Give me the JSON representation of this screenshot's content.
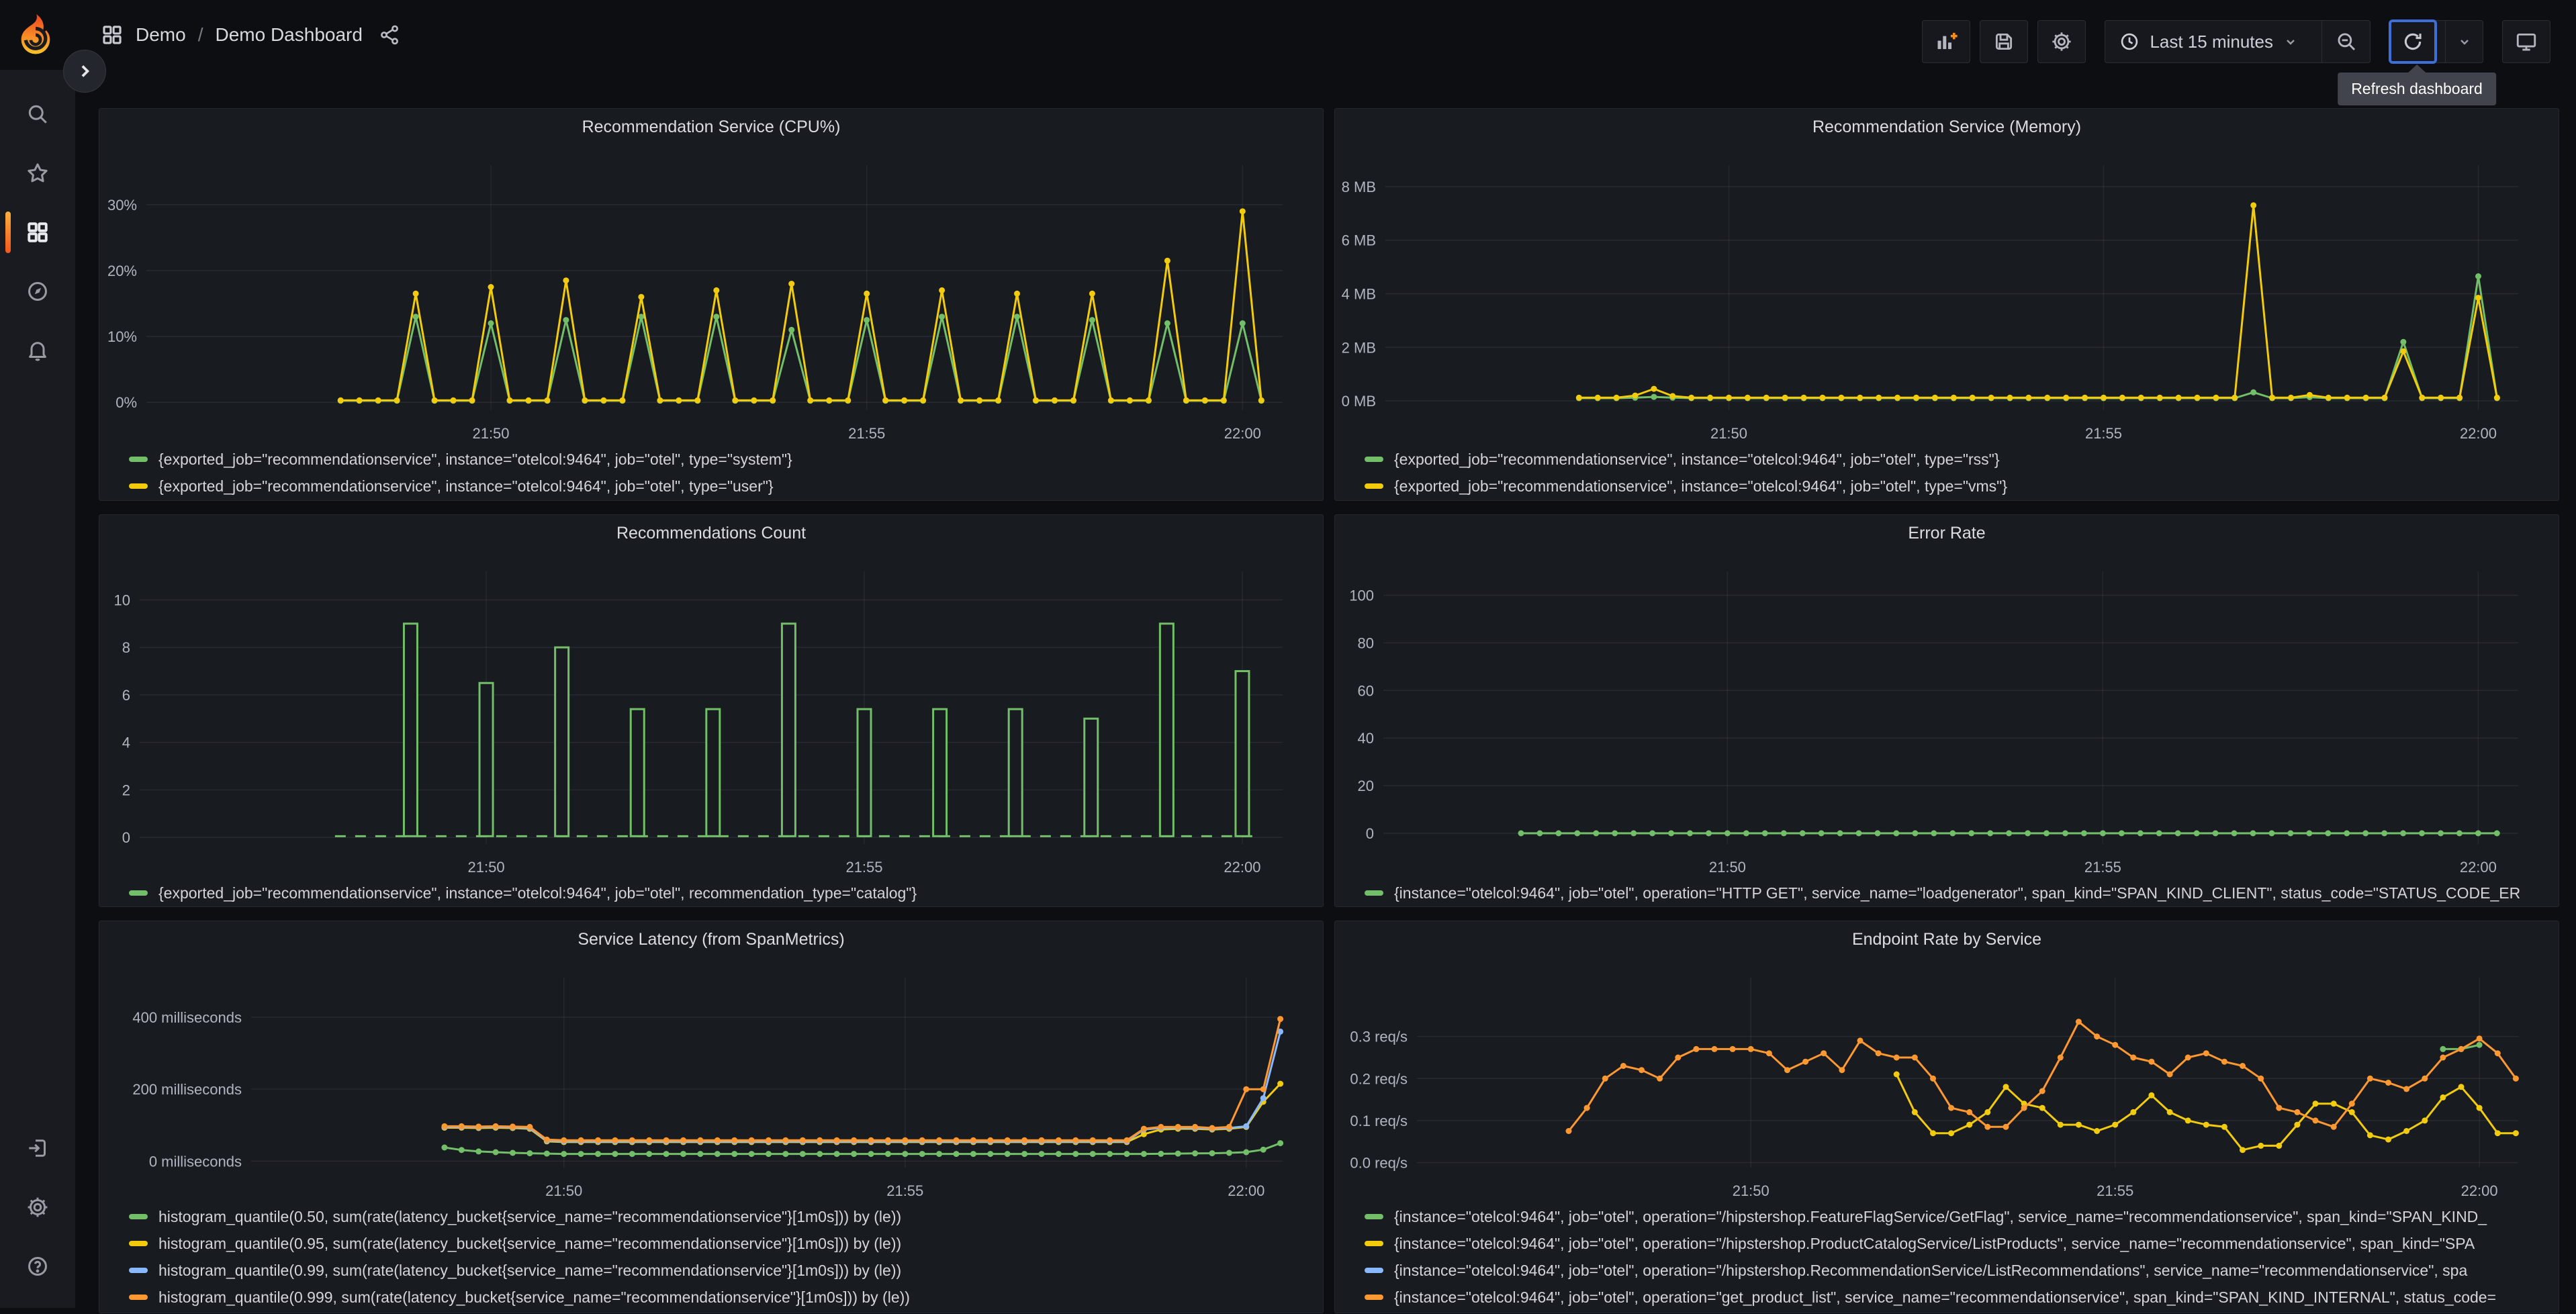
{
  "breadcrumb": {
    "folder": "Demo",
    "separator": "/",
    "title": "Demo Dashboard"
  },
  "toolbar": {
    "time_range": "Last 15 minutes",
    "refresh_tooltip": "Refresh dashboard"
  },
  "colors": {
    "green": "#73bf69",
    "yellow": "#f2cc0c",
    "blue": "#8ab8ff",
    "orange": "#ff9830",
    "accent_orange": "#f2561d",
    "focus_blue": "#3e6fd9"
  },
  "chart_data": [
    {
      "type": "line",
      "title": "Recommendation Service (CPU%)",
      "xlim": [
        -95,
        812
      ],
      "ylim": [
        -1.2,
        36
      ],
      "plot_left": 70,
      "yticks": [
        {
          "v": 0,
          "label": "0%"
        },
        {
          "v": 10,
          "label": "10%"
        },
        {
          "v": 20,
          "label": "20%"
        },
        {
          "v": 30,
          "label": "30%"
        }
      ],
      "xticks": [
        {
          "t": 180,
          "label": "21:50"
        },
        {
          "t": 480,
          "label": "21:55"
        },
        {
          "t": 780,
          "label": "22:00"
        }
      ],
      "series": [
        {
          "label": "{exported_job=\"recommendationservice\", instance=\"otelcol:9464\", job=\"otel\", type=\"system\"}",
          "color": "#73bf69",
          "t0": 60,
          "dt": 15,
          "values": [
            0.25,
            0.25,
            0.25,
            0.25,
            13,
            0.25,
            0.25,
            0.25,
            12,
            0.25,
            0.25,
            0.25,
            12.5,
            0.25,
            0.25,
            0.25,
            13,
            0.25,
            0.25,
            0.25,
            13,
            0.25,
            0.25,
            0.25,
            11,
            0.25,
            0.25,
            0.25,
            12.5,
            0.25,
            0.25,
            0.25,
            13,
            0.25,
            0.25,
            0.25,
            13,
            0.25,
            0.25,
            0.25,
            12.5,
            0.25,
            0.25,
            0.25,
            12,
            0.25,
            0.25,
            0.25,
            12,
            0.25
          ]
        },
        {
          "label": "{exported_job=\"recommendationservice\", instance=\"otelcol:9464\", job=\"otel\", type=\"user\"}",
          "color": "#f2cc0c",
          "t0": 60,
          "dt": 15,
          "values": [
            0.3,
            0.3,
            0.3,
            0.3,
            16.5,
            0.3,
            0.3,
            0.3,
            17.5,
            0.3,
            0.3,
            0.3,
            18.5,
            0.3,
            0.3,
            0.3,
            16,
            0.3,
            0.3,
            0.3,
            17,
            0.3,
            0.3,
            0.3,
            18,
            0.3,
            0.3,
            0.3,
            16.5,
            0.3,
            0.3,
            0.3,
            17,
            0.3,
            0.3,
            0.3,
            16.5,
            0.3,
            0.3,
            0.3,
            16.5,
            0.3,
            0.3,
            0.3,
            21.5,
            0.3,
            0.3,
            0.3,
            29,
            0.3
          ]
        }
      ]
    },
    {
      "type": "line",
      "title": "Recommendation Service (Memory)",
      "xlim": [
        -95,
        812
      ],
      "ylim": [
        -0.35,
        8.8
      ],
      "plot_left": 75,
      "yticks": [
        {
          "v": 0,
          "label": "0 MB"
        },
        {
          "v": 2,
          "label": "2 MB"
        },
        {
          "v": 4,
          "label": "4 MB"
        },
        {
          "v": 6,
          "label": "6 MB"
        },
        {
          "v": 8,
          "label": "8 MB"
        }
      ],
      "xticks": [
        {
          "t": 180,
          "label": "21:50"
        },
        {
          "t": 480,
          "label": "21:55"
        },
        {
          "t": 780,
          "label": "22:00"
        }
      ],
      "series": [
        {
          "label": "{exported_job=\"recommendationservice\", instance=\"otelcol:9464\", job=\"otel\", type=\"rss\"}",
          "color": "#73bf69",
          "t0": 60,
          "dt": 15,
          "values": [
            0.1,
            0.1,
            0.1,
            0.12,
            0.15,
            0.12,
            0.1,
            0.1,
            0.1,
            0.1,
            0.1,
            0.1,
            0.1,
            0.1,
            0.1,
            0.1,
            0.1,
            0.1,
            0.1,
            0.1,
            0.1,
            0.1,
            0.1,
            0.1,
            0.1,
            0.1,
            0.1,
            0.1,
            0.1,
            0.1,
            0.1,
            0.1,
            0.1,
            0.1,
            0.1,
            0.1,
            0.32,
            0.1,
            0.1,
            0.14,
            0.1,
            0.1,
            0.1,
            0.1,
            2.2,
            0.1,
            0.1,
            0.1,
            4.65,
            0.1
          ]
        },
        {
          "label": "{exported_job=\"recommendationservice\", instance=\"otelcol:9464\", job=\"otel\", type=\"vms\"}",
          "color": "#f2cc0c",
          "t0": 60,
          "dt": 15,
          "values": [
            0.12,
            0.12,
            0.12,
            0.2,
            0.45,
            0.18,
            0.12,
            0.12,
            0.12,
            0.12,
            0.12,
            0.12,
            0.12,
            0.12,
            0.12,
            0.12,
            0.12,
            0.12,
            0.12,
            0.12,
            0.12,
            0.12,
            0.12,
            0.12,
            0.12,
            0.12,
            0.12,
            0.12,
            0.12,
            0.12,
            0.12,
            0.12,
            0.12,
            0.12,
            0.12,
            0.12,
            7.3,
            0.12,
            0.12,
            0.22,
            0.12,
            0.12,
            0.12,
            0.12,
            1.85,
            0.12,
            0.12,
            0.12,
            3.85,
            0.12
          ]
        }
      ]
    },
    {
      "type": "line",
      "title": "Recommendations Count",
      "xlim": [
        -95,
        812
      ],
      "ylim": [
        -0.28,
        11.2
      ],
      "plot_left": 60,
      "yticks": [
        {
          "v": 0,
          "label": "0"
        },
        {
          "v": 2,
          "label": "2"
        },
        {
          "v": 4,
          "label": "4"
        },
        {
          "v": 6,
          "label": "6"
        },
        {
          "v": 8,
          "label": "8"
        },
        {
          "v": 10,
          "label": "10"
        }
      ],
      "xticks": [
        {
          "t": 180,
          "label": "21:50"
        },
        {
          "t": 480,
          "label": "21:55"
        },
        {
          "t": 780,
          "label": "22:00"
        }
      ],
      "series": [
        {
          "label": "{exported_job=\"recommendationservice\", instance=\"otelcol:9464\", job=\"otel\", recommendation_type=\"catalog\"}",
          "color": "#73bf69",
          "type": "pulse",
          "t0": 120,
          "dt": 60,
          "base": 0.05,
          "span": [
            60,
            795
          ],
          "heights": [
            9,
            6.5,
            8,
            5.4,
            5.4,
            9,
            5.4,
            5.4,
            5.4,
            5,
            9,
            7
          ],
          "values": []
        }
      ]
    },
    {
      "type": "line",
      "title": "Error Rate",
      "xlim": [
        -95,
        812
      ],
      "ylim": [
        -4.5,
        110
      ],
      "plot_left": 72,
      "yticks": [
        {
          "v": 0,
          "label": "0"
        },
        {
          "v": 20,
          "label": "20"
        },
        {
          "v": 40,
          "label": "40"
        },
        {
          "v": 60,
          "label": "60"
        },
        {
          "v": 80,
          "label": "80"
        },
        {
          "v": 100,
          "label": "100"
        }
      ],
      "xticks": [
        {
          "t": 180,
          "label": "21:50"
        },
        {
          "t": 480,
          "label": "21:55"
        },
        {
          "t": 780,
          "label": "22:00"
        }
      ],
      "series": [
        {
          "label": "{instance=\"otelcol:9464\", job=\"otel\", operation=\"HTTP GET\", service_name=\"loadgenerator\", span_kind=\"SPAN_KIND_CLIENT\", status_code=\"STATUS_CODE_ER",
          "color": "#73bf69",
          "t0": 15,
          "dt": 15,
          "values": [
            0,
            0,
            0,
            0,
            0,
            0,
            0,
            0,
            0,
            0,
            0,
            0,
            0,
            0,
            0,
            0,
            0,
            0,
            0,
            0,
            0,
            0,
            0,
            0,
            0,
            0,
            0,
            0,
            0,
            0,
            0,
            0,
            0,
            0,
            0,
            0,
            0,
            0,
            0,
            0,
            0,
            0,
            0,
            0,
            0,
            0,
            0,
            0,
            0,
            0,
            0,
            0,
            0
          ]
        }
      ]
    },
    {
      "type": "line",
      "title": "Service Latency (from SpanMetrics)",
      "xlim": [
        -95,
        812
      ],
      "ylim": [
        -18,
        510
      ],
      "plot_left": 226,
      "yticks": [
        {
          "v": 0,
          "label": "0 milliseconds"
        },
        {
          "v": 200,
          "label": "200 milliseconds"
        },
        {
          "v": 400,
          "label": "400 milliseconds"
        }
      ],
      "xticks": [
        {
          "t": 180,
          "label": "21:50"
        },
        {
          "t": 480,
          "label": "21:55"
        },
        {
          "t": 780,
          "label": "22:00"
        }
      ],
      "series": [
        {
          "label": "histogram_quantile(0.50, sum(rate(latency_bucket{service_name=\"recommendationservice\"}[1m0s])) by (le))",
          "color": "#73bf69",
          "t0": 75,
          "dt": 15,
          "values": [
            38,
            31,
            27,
            25,
            23,
            22,
            21,
            20,
            20,
            20,
            20,
            20,
            20,
            20,
            20,
            20,
            20,
            20,
            20,
            20,
            20,
            20,
            20,
            20,
            20,
            20,
            20,
            20,
            20,
            20,
            20,
            20,
            20,
            20,
            20,
            20,
            20,
            20,
            20,
            20,
            20,
            20,
            20.5,
            21,
            21.5,
            22,
            23,
            25,
            32,
            50
          ]
        },
        {
          "label": "histogram_quantile(0.95, sum(rate(latency_bucket{service_name=\"recommendationservice\"}[1m0s])) by (le))",
          "color": "#f2cc0c",
          "t0": 75,
          "dt": 15,
          "values": [
            93,
            93,
            92,
            93,
            92,
            90,
            55,
            53,
            53,
            53,
            53,
            53,
            53,
            53,
            53,
            53,
            53,
            53,
            53,
            53,
            53,
            53,
            53,
            53,
            53,
            53,
            53,
            53,
            53,
            53,
            53,
            53,
            53,
            53,
            53,
            53,
            53,
            53,
            53,
            53,
            53,
            75,
            88,
            90,
            90,
            88,
            90,
            95,
            165,
            215
          ]
        },
        {
          "label": "histogram_quantile(0.99, sum(rate(latency_bucket{service_name=\"recommendationservice\"}[1m0s])) by (le))",
          "color": "#8ab8ff",
          "t0": 75,
          "dt": 15,
          "values": [
            95,
            95,
            94,
            95,
            94,
            92,
            57,
            55,
            55,
            55,
            55,
            55,
            55,
            55,
            55,
            55,
            55,
            55,
            55,
            55,
            55,
            55,
            55,
            55,
            55,
            55,
            55,
            55,
            55,
            55,
            55,
            55,
            55,
            55,
            55,
            55,
            55,
            55,
            55,
            55,
            55,
            88,
            92,
            93,
            92,
            90,
            92,
            97,
            175,
            360
          ]
        },
        {
          "label": "histogram_quantile(0.999, sum(rate(latency_bucket{service_name=\"recommendationservice\"}[1m0s])) by (le))",
          "color": "#ff9830",
          "t0": 75,
          "dt": 15,
          "values": [
            97,
            97,
            96,
            97,
            96,
            95,
            60,
            58,
            58,
            58,
            58,
            58,
            58,
            58,
            58,
            58,
            58,
            58,
            58,
            58,
            58,
            58,
            58,
            58,
            58,
            58,
            58,
            58,
            58,
            58,
            58,
            58,
            58,
            58,
            58,
            58,
            58,
            58,
            58,
            58,
            58,
            90,
            95,
            95,
            95,
            92,
            95,
            200,
            200,
            395
          ]
        }
      ]
    },
    {
      "type": "line",
      "title": "Endpoint Rate by Service",
      "xlim": [
        -95,
        812
      ],
      "ylim": [
        -0.012,
        0.44
      ],
      "plot_left": 122,
      "yticks": [
        {
          "v": 0,
          "label": "0.0 req/s"
        },
        {
          "v": 0.1,
          "label": "0.1 req/s"
        },
        {
          "v": 0.2,
          "label": "0.2 req/s"
        },
        {
          "v": 0.3,
          "label": "0.3 req/s"
        }
      ],
      "xticks": [
        {
          "t": 180,
          "label": "21:50"
        },
        {
          "t": 480,
          "label": "21:55"
        },
        {
          "t": 780,
          "label": "22:00"
        }
      ],
      "series": [
        {
          "label": "{instance=\"otelcol:9464\", job=\"otel\", operation=\"/hipstershop.FeatureFlagService/GetFlag\", service_name=\"recommendationservice\", span_kind=\"SPAN_KIND_",
          "color": "#73bf69",
          "t0": 750,
          "dt": 15,
          "values": [
            0.27,
            0.27,
            0.28
          ]
        },
        {
          "label": "{instance=\"otelcol:9464\", job=\"otel\", operation=\"/hipstershop.ProductCatalogService/ListProducts\", service_name=\"recommendationservice\", span_kind=\"SPA",
          "color": "#f2cc0c",
          "t0": 300,
          "dt": 15,
          "values": [
            0.21,
            0.12,
            0.07,
            0.07,
            0.09,
            0.12,
            0.18,
            0.14,
            0.13,
            0.09,
            0.09,
            0.075,
            0.09,
            0.12,
            0.16,
            0.12,
            0.1,
            0.09,
            0.085,
            0.03,
            0.04,
            0.04,
            0.09,
            0.14,
            0.14,
            0.12,
            0.065,
            0.055,
            0.075,
            0.1,
            0.155,
            0.18,
            0.13,
            0.07,
            0.07
          ]
        },
        {
          "label": "{instance=\"otelcol:9464\", job=\"otel\", operation=\"/hipstershop.RecommendationService/ListRecommendations\", service_name=\"recommendationservice\", spa",
          "color": "#8ab8ff",
          "t0": 750,
          "dt": 15,
          "values": []
        },
        {
          "label": "{instance=\"otelcol:9464\", job=\"otel\", operation=\"get_product_list\", service_name=\"recommendationservice\", span_kind=\"SPAN_KIND_INTERNAL\", status_code=",
          "color": "#ff9830",
          "t0": 30,
          "dt": 15,
          "values": [
            0.075,
            0.13,
            0.2,
            0.23,
            0.22,
            0.2,
            0.25,
            0.27,
            0.27,
            0.27,
            0.27,
            0.26,
            0.22,
            0.24,
            0.26,
            0.22,
            0.29,
            0.26,
            0.25,
            0.25,
            0.2,
            0.13,
            0.12,
            0.085,
            0.085,
            0.13,
            0.17,
            0.25,
            0.335,
            0.3,
            0.28,
            0.25,
            0.24,
            0.21,
            0.25,
            0.26,
            0.24,
            0.23,
            0.2,
            0.13,
            0.12,
            0.1,
            0.085,
            0.14,
            0.2,
            0.19,
            0.175,
            0.2,
            0.25,
            0.27,
            0.295,
            0.26,
            0.2
          ]
        }
      ]
    }
  ]
}
